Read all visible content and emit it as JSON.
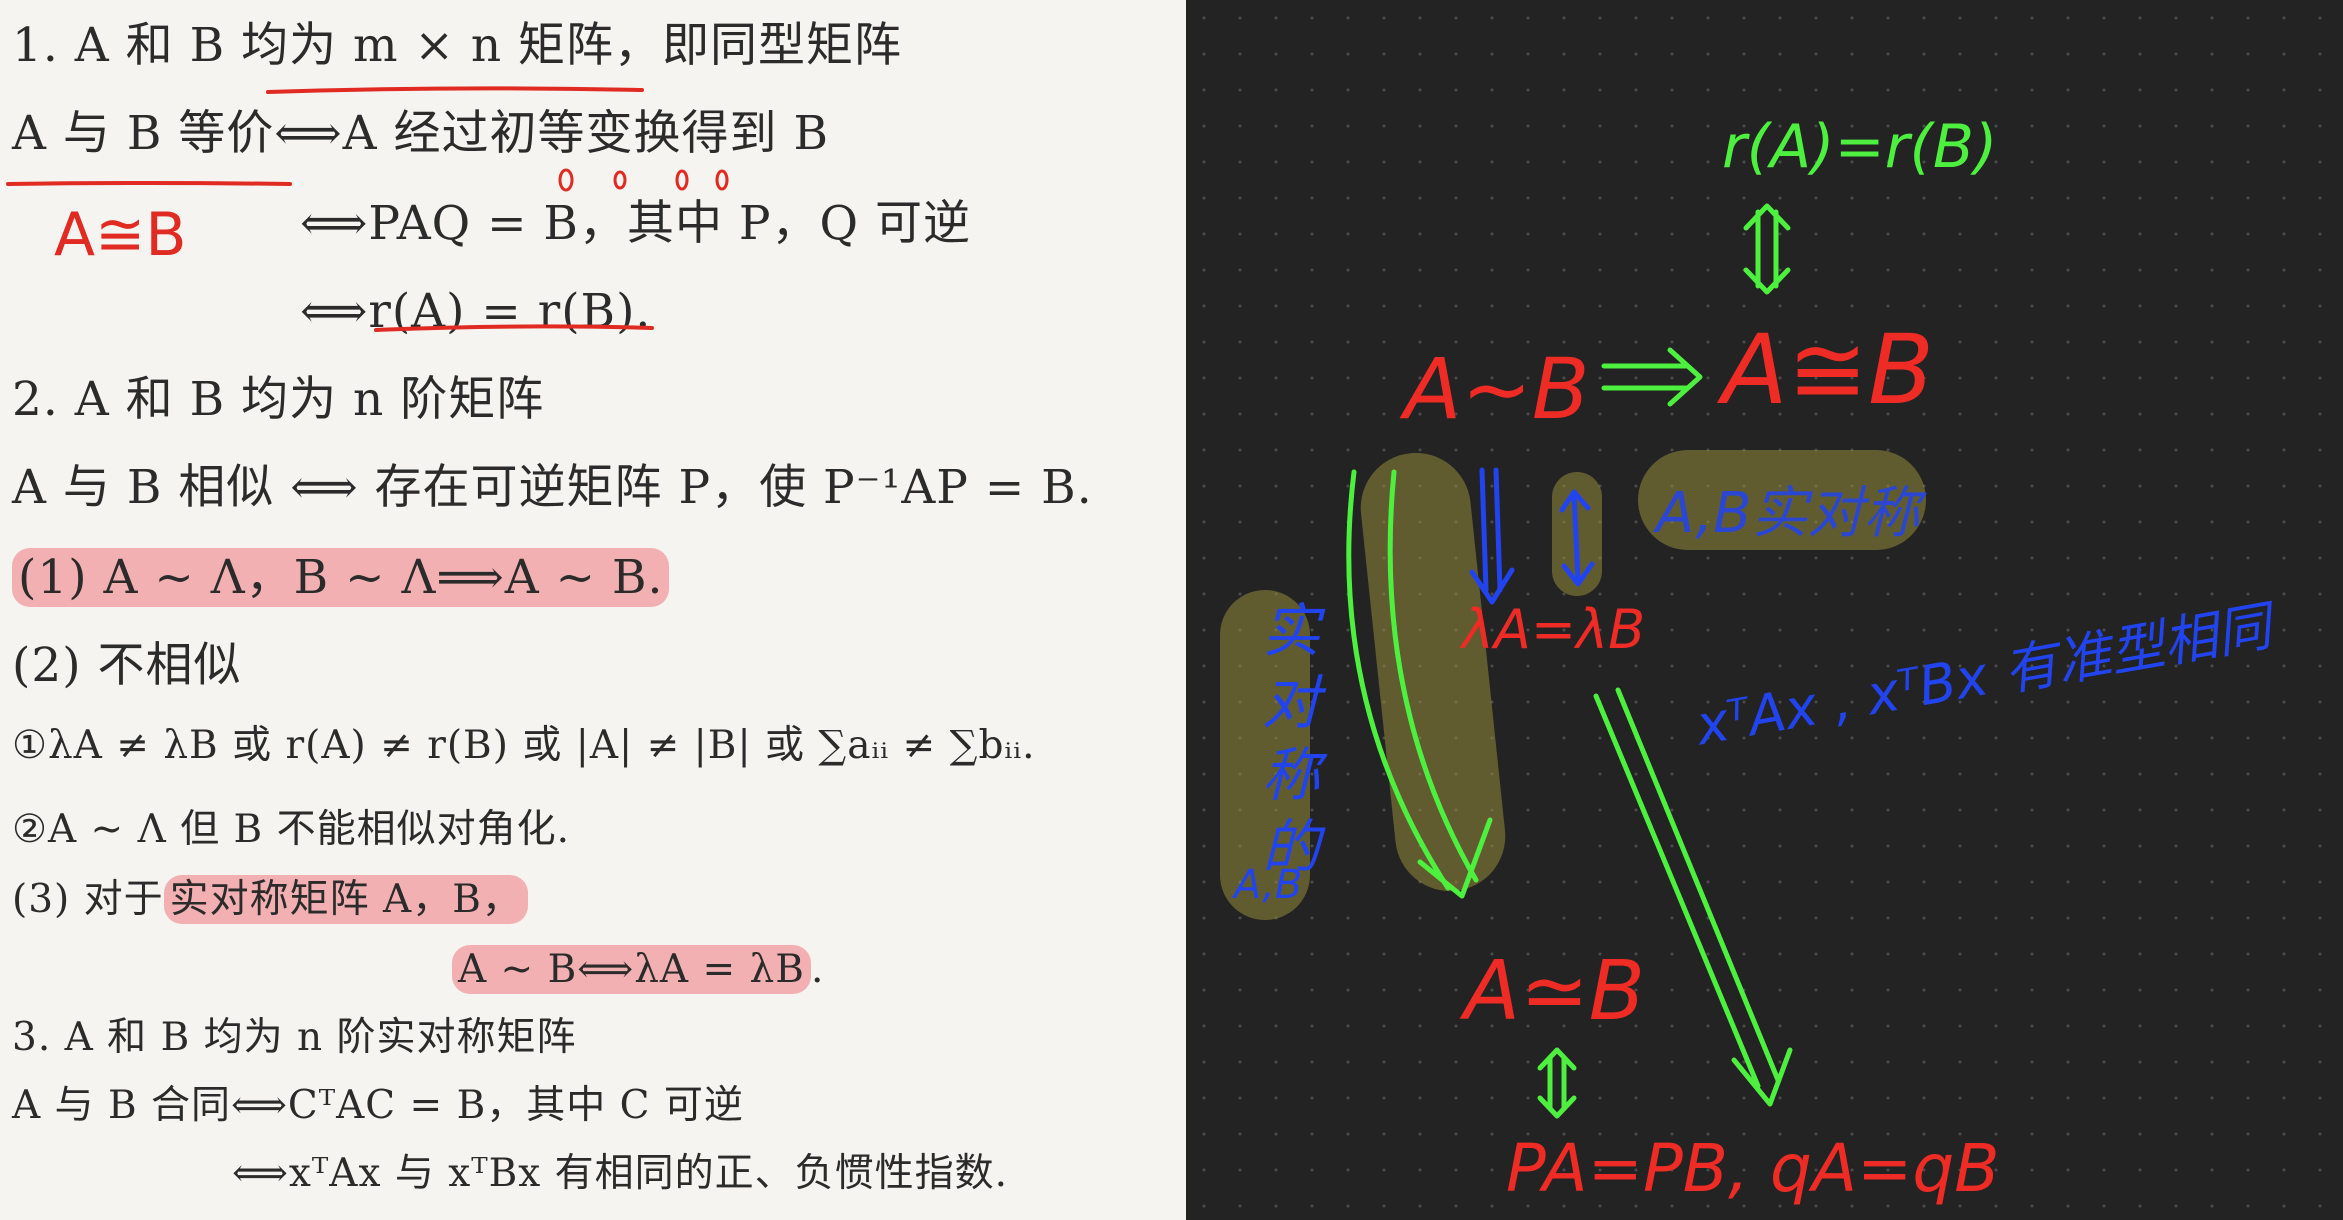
{
  "textbook": {
    "s1_heading": "1. A 和 B 均为 m × n 矩阵，即同型矩阵",
    "s1_line1": "A 与 B 等价⟺A 经过初等变换得到 B",
    "s1_line2": "⟺PAQ = B，其中 P，Q 可逆",
    "s1_line3": "⟺r(A) = r(B).",
    "s2_heading": "2. A 和 B 均为 n 阶矩阵",
    "s2_line1": "A 与 B 相似 ⟺ 存在可逆矩阵 P，使 P⁻¹AP = B.",
    "s2_item1": "(1) A ~ Λ，B ~ Λ⟹A ~ B.",
    "s2_item2": "(2) 不相似",
    "s2_item2a": "①λA ≠ λB 或 r(A) ≠ r(B) 或 |A| ≠ |B| 或 ∑aᵢᵢ ≠ ∑bᵢᵢ.",
    "s2_item2b": "②A ~ Λ 但 B 不能相似对角化.",
    "s2_item3_prefix": "(3) 对于",
    "s2_item3_hl": "实对称矩阵 A，B，",
    "s2_item3_line2": "A ~ B⟺λA = λB",
    "s2_item3_end": ".",
    "s3_heading": "3. A 和 B 均为 n 阶实对称矩阵",
    "s3_line1": "A 与 B 合同⟺CᵀAC = B，其中 C 可逆",
    "s3_line2": "⟺xᵀAx 与 xᵀBx 有相同的正、负惯性指数."
  },
  "annotation": {
    "equiv_symbol": "A≅B"
  },
  "notes": {
    "rank_eq": "r(A)=r(B)",
    "similar": "A∼B",
    "equivalent": "A≅B",
    "real_sym_ab": "A,B实对称",
    "eigen_eq": "λA=λB",
    "quad_form": "xᵀAx , xᵀBx 有准型相同",
    "real_sym_vertical": "实对称的",
    "ab_small": "A,B",
    "congruent": "A≃B",
    "inertia": "PA=PB, qA=qB"
  },
  "colors": {
    "red": "#ee2b24",
    "green": "#4ef03f",
    "blue": "#2244ee",
    "highlight": "#ee7880",
    "canvas": "#232323"
  }
}
